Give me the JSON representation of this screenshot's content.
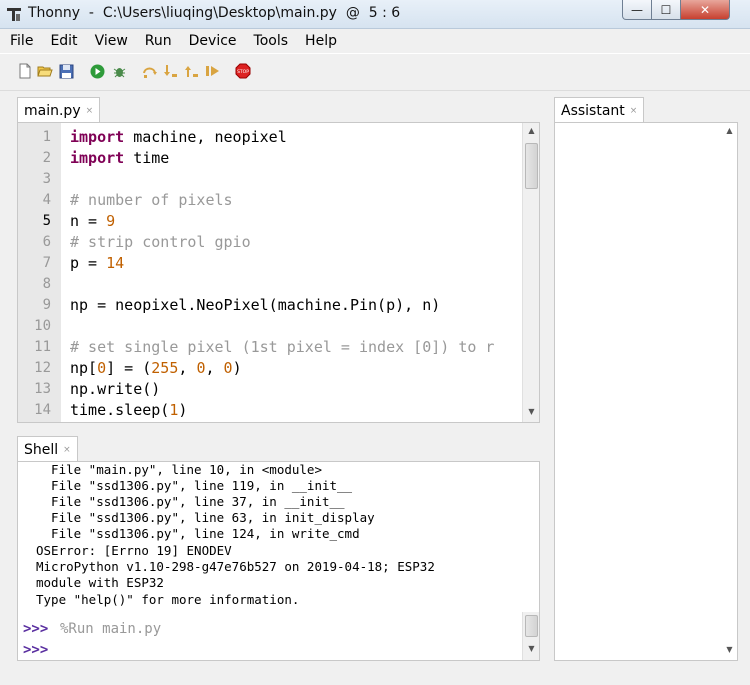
{
  "window": {
    "title": "Thonny  -  C:\\Users\\liuqing\\Desktop\\main.py  @  5 : 6",
    "min_glyph": "—",
    "max_glyph": "☐",
    "close_glyph": "✕"
  },
  "menubar": [
    "File",
    "Edit",
    "View",
    "Run",
    "Device",
    "Tools",
    "Help"
  ],
  "toolbar": {
    "icons": [
      "new-file-icon",
      "open-file-icon",
      "save-icon",
      "run-icon",
      "debug-icon",
      "step-over-icon",
      "step-into-icon",
      "step-out-icon",
      "resume-icon",
      "stop-icon"
    ]
  },
  "editor": {
    "tab_label": "main.py",
    "tab_close": "×",
    "line_numbers": [
      "1",
      "2",
      "3",
      "4",
      "5",
      "6",
      "7",
      "8",
      "9",
      "10",
      "11",
      "12",
      "13",
      "14"
    ]
  },
  "code": {
    "l1_kw": "import",
    "l1_rest": " machine, neopixel",
    "l2_kw": "import",
    "l2_rest": " time",
    "l4_comment": "# number of pixels",
    "l5_pre": "n = ",
    "l5_num": "9",
    "l6_comment": "# strip control gpio",
    "l7_pre": "p = ",
    "l7_num": "14",
    "l9": "np = neopixel.NeoPixel(machine.Pin(p), n)",
    "l11_comment": "# set single pixel (1st pixel = index [0]) to r",
    "l12_a": "np[",
    "l12_b": "0",
    "l12_c": "] = (",
    "l12_d": "255",
    "l12_e": ", ",
    "l12_f": "0",
    "l12_g": ", ",
    "l12_h": "0",
    "l12_i": ")",
    "l13": "np.write()",
    "l14_a": "time.sleep(",
    "l14_b": "1",
    "l14_c": ")"
  },
  "shell": {
    "tab_label": "Shell",
    "tab_close": "×",
    "lines": [
      "  File \"main.py\", line 10, in <module>",
      "  File \"ssd1306.py\", line 119, in __init__",
      "  File \"ssd1306.py\", line 37, in __init__",
      "  File \"ssd1306.py\", line 63, in init_display",
      "  File \"ssd1306.py\", line 124, in write_cmd",
      "OSError: [Errno 19] ENODEV",
      "MicroPython v1.10-298-g47e76b527 on 2019-04-18; ESP32",
      "module with ESP32",
      "Type \"help()\" for more information."
    ],
    "prompt": ">>>",
    "run_command": "%Run main.py"
  },
  "assistant": {
    "tab_label": "Assistant",
    "tab_close": "×"
  },
  "colors": {
    "keyword": "#7f0055",
    "comment": "#999999",
    "number": "#c06000",
    "prompt": "#5a2fa0"
  }
}
